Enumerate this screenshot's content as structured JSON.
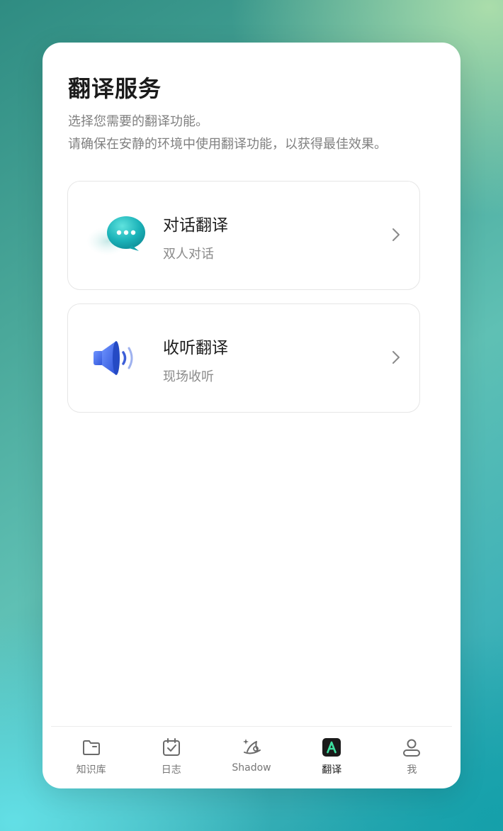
{
  "page": {
    "title": "翻译服务",
    "subtitle_line1": "选择您需要的翻译功能。",
    "subtitle_line2": "请确保在安静的环境中使用翻译功能，以获得最佳效果。"
  },
  "features": [
    {
      "title": "对话翻译",
      "desc": "双人对话",
      "icon": "chat-bubble-icon"
    },
    {
      "title": "收听翻译",
      "desc": "现场收听",
      "icon": "speaker-icon"
    }
  ],
  "tabs": [
    {
      "label": "知识库",
      "icon": "folder-icon"
    },
    {
      "label": "日志",
      "icon": "calendar-check-icon"
    },
    {
      "label": "Shadow",
      "icon": "wizard-hat-icon"
    },
    {
      "label": "翻译",
      "icon": "translate-a-icon",
      "active": true
    },
    {
      "label": "我",
      "icon": "user-icon"
    }
  ],
  "colors": {
    "accent_green": "#3ee0a0",
    "chat_teal": "#1cb3b9",
    "speaker_blue": "#3d6ef0",
    "active_tab_bg": "#1a1a1a"
  }
}
